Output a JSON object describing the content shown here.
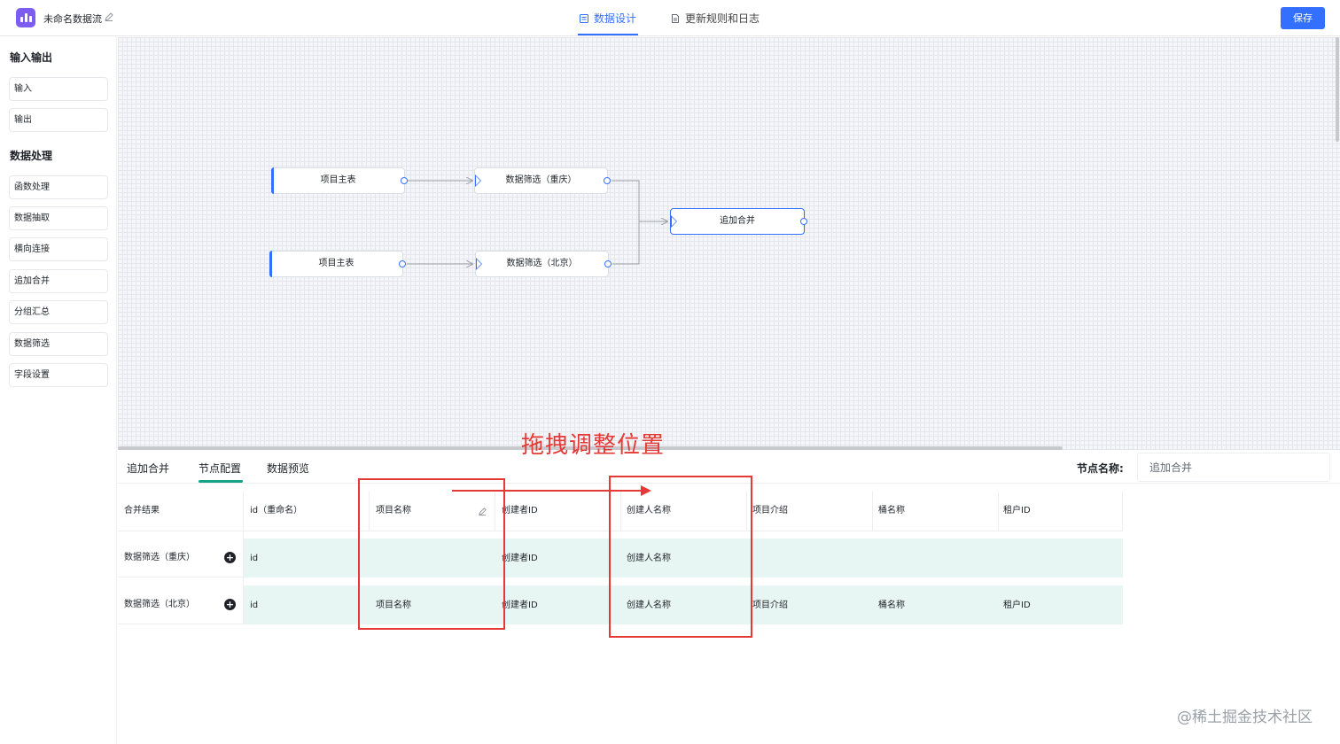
{
  "header": {
    "app_title": "未命名数据流",
    "tabs": [
      {
        "label": "数据设计",
        "active": true
      },
      {
        "label": "更新规则和日志",
        "active": false
      }
    ],
    "save_label": "保存",
    "accent_color": "#3370ff"
  },
  "sidebar": {
    "groups": [
      {
        "title": "输入输出",
        "items": [
          "输入",
          "输出"
        ]
      },
      {
        "title": "数据处理",
        "items": [
          "函数处理",
          "数据抽取",
          "横向连接",
          "追加合并",
          "分组汇总",
          "数据筛选",
          "字段设置"
        ]
      }
    ]
  },
  "canvas": {
    "nodes": [
      {
        "label": "项目主表"
      },
      {
        "label": "数据筛选（重庆）"
      },
      {
        "label": "项目主表"
      },
      {
        "label": "数据筛选（北京）"
      },
      {
        "label": "追加合并"
      }
    ]
  },
  "panel": {
    "tabs": [
      "追加合并",
      "节点配置",
      "数据预览"
    ],
    "active_tab": "节点配置",
    "node_name_label": "节点名称:",
    "node_name_value": "追加合并",
    "table": {
      "header": [
        "合并结果",
        "id（重命名）",
        "项目名称",
        "创建者ID",
        "创建人名称",
        "项目介绍",
        "桶名称",
        "租户ID"
      ],
      "rows": [
        {
          "source": "数据筛选（重庆）",
          "cells": [
            "id",
            "",
            "创建者ID",
            "创建人名称",
            "",
            "",
            ""
          ]
        },
        {
          "source": "数据筛选（北京）",
          "cells": [
            "id",
            "项目名称",
            "创建者ID",
            "创建人名称",
            "项目介绍",
            "桶名称",
            "租户ID"
          ]
        }
      ]
    }
  },
  "annotation": {
    "text": "拖拽调整位置",
    "color": "#e53935"
  },
  "watermark": "@稀土掘金技术社区"
}
